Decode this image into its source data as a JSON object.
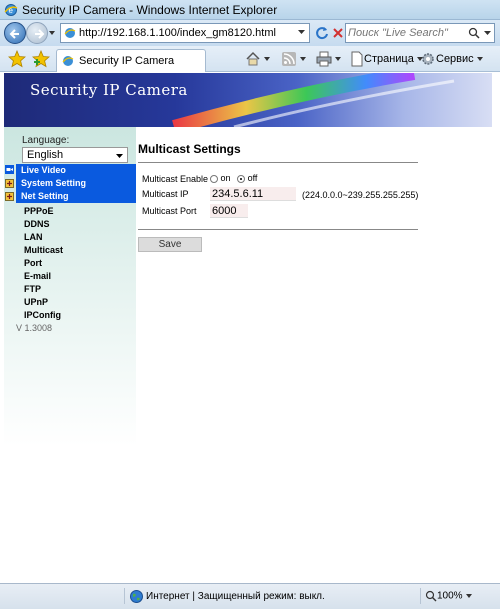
{
  "window": {
    "title": "Security IP Camera - Windows Internet Explorer"
  },
  "address": {
    "url": "http://192.168.1.100/index_gm8120.html",
    "search_placeholder": "Поиск \"Live Search\""
  },
  "commandbar": {
    "tab_label": "Security IP Camera",
    "page_menu": "Страница",
    "tools_menu": "Сервис"
  },
  "banner": {
    "title": "Security IP Camera"
  },
  "sidebar": {
    "language_label": "Language:",
    "language_value": "English",
    "menu": [
      "Live Video",
      "System Setting",
      "Net Setting"
    ],
    "subitems": [
      "PPPoE",
      "DDNS",
      "LAN",
      "Multicast",
      "Port",
      "E-mail",
      "FTP",
      "UPnP",
      "IPConfig"
    ],
    "version": "V 1.3008"
  },
  "content": {
    "title": "Multicast Settings",
    "enable_label": "Multicast Enable",
    "on_label": "on",
    "off_label": "off",
    "enable_value": "off",
    "ip_label": "Multicast IP",
    "ip_value": "234.5.6.11",
    "ip_hint": "(224.0.0.0~239.255.255.255)",
    "port_label": "Multicast Port",
    "port_value": "6000",
    "save_label": "Save"
  },
  "status": {
    "zone_text": "Интернет | Защищенный режим: выкл.",
    "zoom": "100%"
  },
  "colors": {
    "menu_bar": "#0a5adf",
    "sidebar_top": "#cbe6e0",
    "banner_dark": "#1e2a78"
  }
}
